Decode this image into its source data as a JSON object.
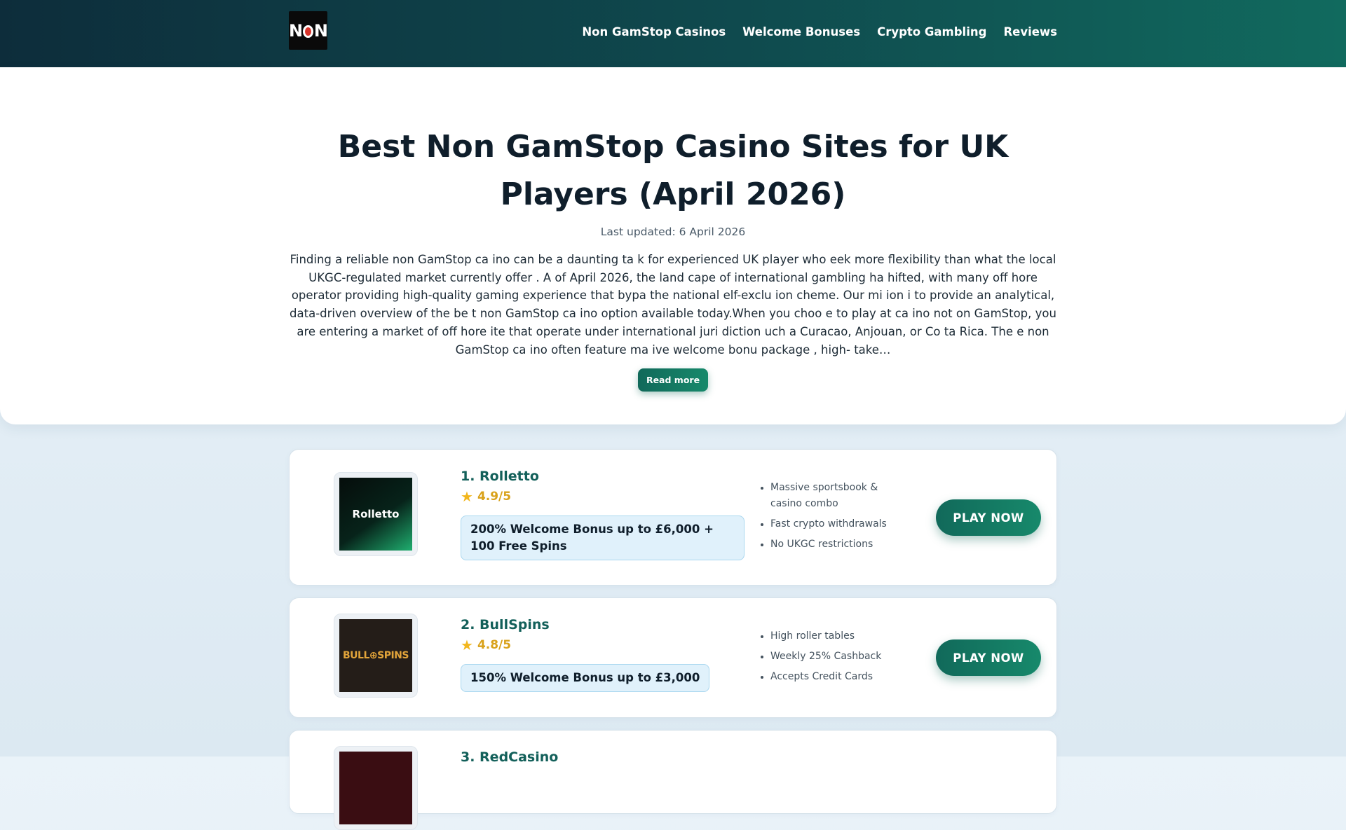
{
  "header": {
    "logo_text": "NON",
    "nav": [
      "Non GamStop Casinos",
      "Welcome Bonuses",
      "Crypto Gambling",
      "Reviews"
    ]
  },
  "hero": {
    "title": "Best Non GamStop Casino Sites for UK Players (April 2026)",
    "updated": "Last updated: 6 April 2026",
    "intro": "Finding a reliable non GamStop ca ino can be a daunting ta k for experienced UK player who eek more flexibility than what the local UKGC-regulated market currently offer . A of April 2026, the land cape of international gambling ha hifted, with many off hore operator providing high-quality gaming experience that bypa the national elf-exclu ion cheme. Our mi ion i to provide an analytical, data-driven overview of the be t non GamStop ca ino option available today.When you choo e to play at ca ino not on GamStop, you are entering a market of off hore ite that operate under international juri diction uch a Curacao, Anjouan, or Co ta Rica. The e non GamStop ca ino often feature ma ive welcome bonu package , high- take…",
    "read_more": "Read more"
  },
  "casinos": [
    {
      "name": "1. Rolletto",
      "logo_text": "Rolletto",
      "rating": "4.9/5",
      "bonus": "200% Welcome Bonus up to £6,000 + 100 Free Spins",
      "features": [
        "Massive sportsbook & casino combo",
        "Fast crypto withdrawals",
        "No UKGC restrictions"
      ],
      "cta": "PLAY NOW"
    },
    {
      "name": "2. BullSpins",
      "logo_text": "BULL⊕SPINS",
      "rating": "4.8/5",
      "bonus": "150% Welcome Bonus up to £3,000",
      "features": [
        "High roller tables",
        "Weekly 25% Cashback",
        "Accepts Credit Cards"
      ],
      "cta": "PLAY NOW"
    },
    {
      "name": "3. RedCasino"
    }
  ],
  "colors": {
    "header_start": "#0d2d3b",
    "header_end": "#116a5e",
    "accent": "#17896b",
    "title_green": "#13605a",
    "rating_gold": "#d9a21b",
    "bonus_bg": "#e0f1fb"
  },
  "icons": [
    "star-icon"
  ]
}
